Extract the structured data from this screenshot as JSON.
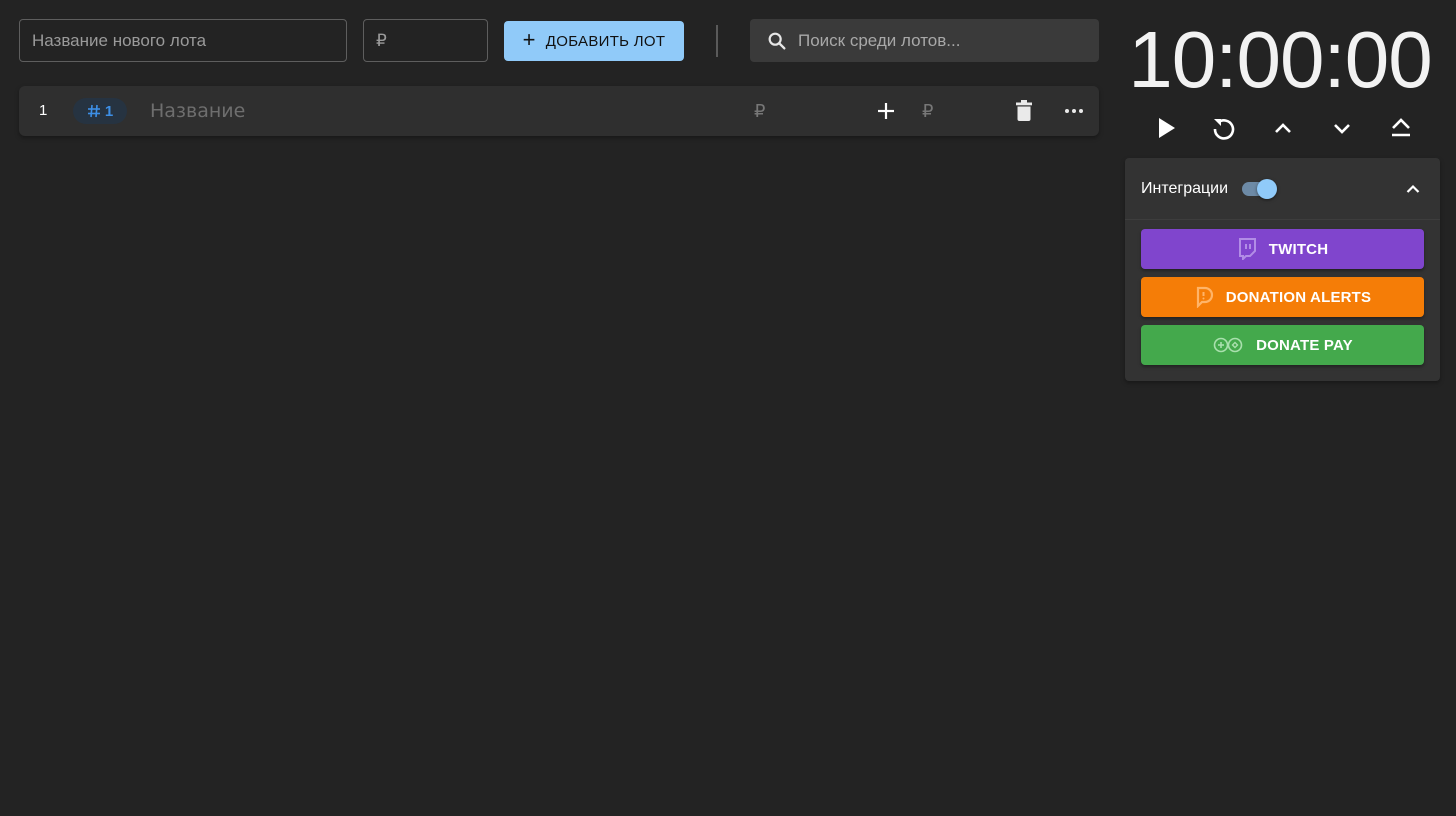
{
  "toolbar": {
    "new_lot_placeholder": "Название нового лота",
    "price_placeholder": "₽",
    "add_lot_label": "ДОБАВИТЬ ЛОТ",
    "search_placeholder": "Поиск среди лотов...",
    "accent_color": "#90caf9"
  },
  "lots": [
    {
      "index": "1",
      "id_label": "1",
      "name_placeholder": "Название",
      "amount_placeholder": "₽",
      "add_amount_placeholder": "₽"
    }
  ],
  "timer": {
    "display": "10:00:00",
    "controls": [
      "play-icon",
      "reset-icon",
      "chevron-up-icon",
      "chevron-down-icon",
      "eject-icon"
    ]
  },
  "integrations": {
    "title": "Интеграции",
    "enabled": true,
    "buttons": [
      {
        "label": "TWITCH",
        "color": "#8045cd",
        "icon": "twitch-icon"
      },
      {
        "label": "DONATION ALERTS",
        "color": "#f57d07",
        "icon": "donation-alerts-icon"
      },
      {
        "label": "DONATE PAY",
        "color": "#44a94c",
        "icon": "donatepay-icon"
      }
    ]
  }
}
